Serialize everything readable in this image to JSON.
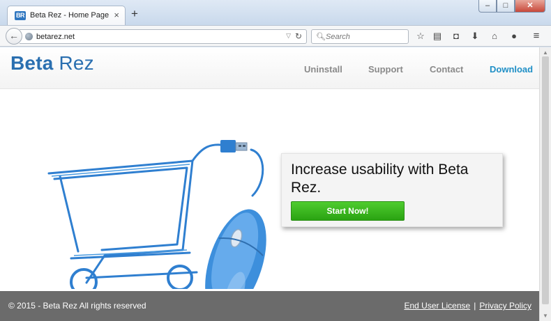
{
  "browser": {
    "tab_title": "Beta Rez - Home Page",
    "favicon_text": "BR",
    "url": "betarez.net",
    "search_placeholder": "Search",
    "icons": {
      "back": "back-arrow-icon",
      "new_tab": "plus-icon",
      "reload": "reload-icon",
      "bookmark": "star-icon",
      "reading_list": "clipboard-icon",
      "pocket": "pocket-icon",
      "downloads": "download-icon",
      "home": "home-icon",
      "chat": "chat-icon",
      "menu": "hamburger-icon"
    }
  },
  "site": {
    "logo_bold": "Beta",
    "logo_light": "Rez",
    "nav": [
      "Uninstall",
      "Support",
      "Contact",
      "Download"
    ]
  },
  "hero": {
    "headline": "Increase usability with Beta Rez.",
    "cta_label": "Start Now!"
  },
  "footer": {
    "copyright": "© 2015 - Beta Rez All rights reserved",
    "links": [
      "End User License",
      "Privacy Policy"
    ],
    "separator": "|"
  },
  "colors": {
    "brand_blue": "#2a6fb0",
    "nav_accent": "#1f8fc6",
    "cta_green": "#2aa312",
    "footer_gray": "#6b6b6b"
  }
}
